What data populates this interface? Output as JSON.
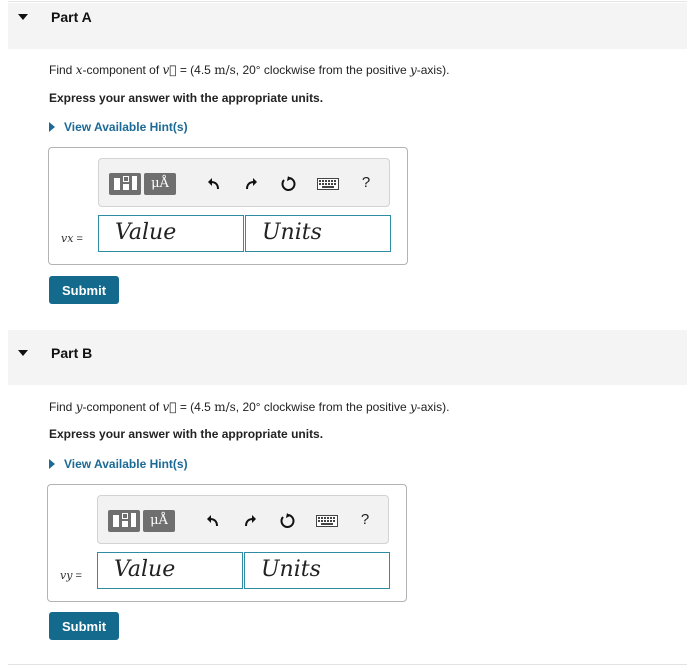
{
  "parts": [
    {
      "title": "Part A",
      "question_pre": "Find ",
      "question_var": "x",
      "question_mid": "-component of ",
      "question_vec": "v⃗",
      "question_eq": " = (4.5 ",
      "question_unit": "m/s",
      "question_post": ", 20° clockwise from the positive ",
      "question_axis": "y",
      "question_end": "-axis).",
      "instruction": "Express your answer with the appropriate units.",
      "hint_label": "View Available Hint(s)",
      "var_symbol": "vx",
      "var_equals": " =",
      "value_placeholder": "Value",
      "units_placeholder": "Units",
      "submit_label": "Submit"
    },
    {
      "title": "Part B",
      "question_pre": "Find ",
      "question_var": "y",
      "question_mid": "-component of ",
      "question_vec": "v⃗",
      "question_eq": " = (4.5 ",
      "question_unit": "m/s",
      "question_post": ", 20° clockwise from the positive ",
      "question_axis": "y",
      "question_end": "-axis).",
      "instruction": "Express your answer with the appropriate units.",
      "hint_label": "View Available Hint(s)",
      "var_symbol": "vy",
      "var_equals": " =",
      "value_placeholder": "Value",
      "units_placeholder": "Units",
      "submit_label": "Submit"
    }
  ],
  "toolbar": {
    "units_tool_label": "μÅ",
    "help_label": "?",
    "icons": [
      "templates-icon",
      "units-icon",
      "undo-icon",
      "redo-icon",
      "reset-icon",
      "keyboard-icon",
      "help-icon"
    ]
  },
  "colors": {
    "accent": "#146a8c",
    "link": "#1c6a96",
    "input_border": "#2f8ca3",
    "header_bg": "#f4f4f4"
  }
}
